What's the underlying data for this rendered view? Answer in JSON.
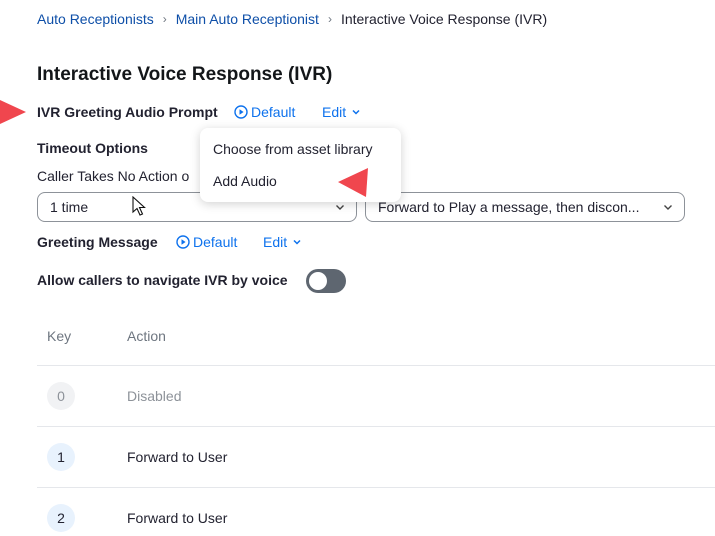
{
  "breadcrumb": {
    "items": [
      "Auto Receptionists",
      "Main Auto Receptionist"
    ],
    "current": "Interactive Voice Response (IVR)"
  },
  "page_title": "Interactive Voice Response (IVR)",
  "ivr_greeting": {
    "label": "IVR Greeting Audio Prompt",
    "audio_link": "Default",
    "edit_label": "Edit"
  },
  "timeout": {
    "heading": "Timeout Options",
    "caller_label": "Caller Takes No Action o",
    "times_value": "1 time",
    "action_value": "Forward to Play a message, then discon..."
  },
  "greeting_message": {
    "label": "Greeting Message",
    "audio_link": "Default",
    "edit_label": "Edit"
  },
  "voice_nav": {
    "label": "Allow callers to navigate IVR by voice",
    "enabled": false
  },
  "table": {
    "headers": {
      "key": "Key",
      "action": "Action"
    },
    "rows": [
      {
        "key": "0",
        "action": "Disabled",
        "disabled": true
      },
      {
        "key": "1",
        "action": "Forward to User",
        "disabled": false
      },
      {
        "key": "2",
        "action": "Forward to User",
        "disabled": false
      }
    ]
  },
  "dropdown_menu": {
    "items": [
      "Choose from asset library",
      "Add Audio"
    ]
  },
  "colors": {
    "link": "#0e72ed",
    "breadcrumb_link": "#0e4fa8",
    "annotation_arrow": "#f0464e",
    "toggle_off": "#5e6670"
  },
  "icons": {
    "play": "play-circle-icon",
    "chevron": "chevron-down-icon",
    "cursor": "mouse-pointer-icon",
    "annotation": "red-arrow-icon"
  }
}
